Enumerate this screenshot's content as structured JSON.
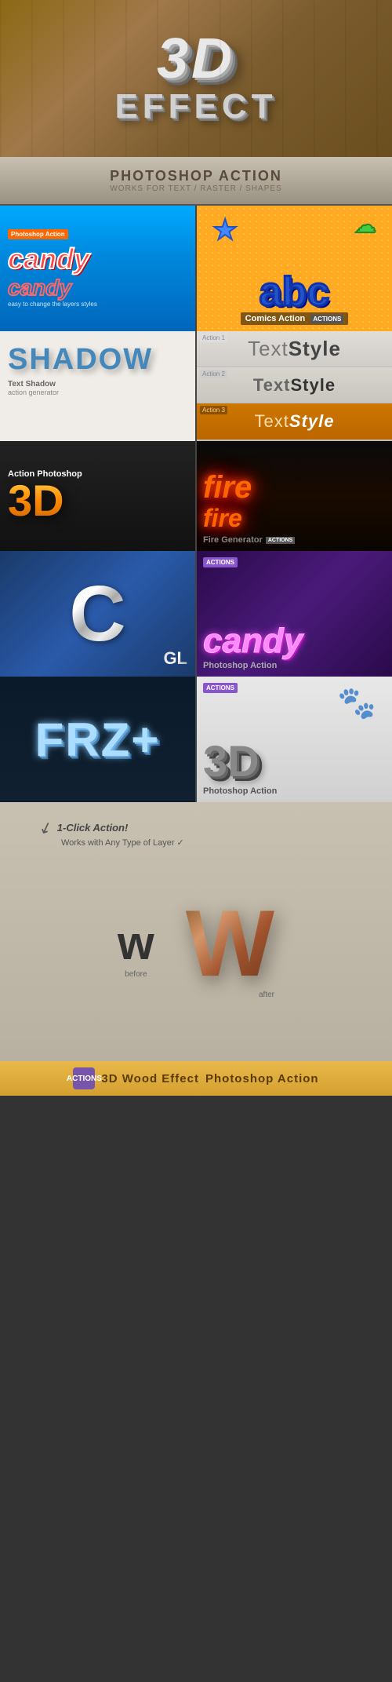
{
  "hero": {
    "text3d": "3D",
    "effect": "EFFECT"
  },
  "banner": {
    "title": "PHOTOSHOP ACTION",
    "subtitle": "WORKS FOR TEXT / RASTER / SHAPES"
  },
  "cards": {
    "candy1": {
      "badge": "Photoshop Action",
      "text1": "candy",
      "text2": "candy",
      "small": "easy to change the layers styles"
    },
    "comics": {
      "abc": "abc",
      "label": "Comics Action",
      "actions": "ACTIONS"
    },
    "shadow": {
      "main": "SHADOW",
      "sub1": "Text Shadow",
      "sub2": "action generator"
    },
    "textstyle": {
      "action1": "Action 1",
      "action2": "Action 2",
      "action3": "Action 3",
      "label_light1": "Text",
      "label_bold1": "Style",
      "label_light2": "Text",
      "label_bold2": "Style",
      "label_italic": "Text Style"
    },
    "action3d": {
      "title": "Action Photoshop",
      "text": "3D"
    },
    "fire": {
      "text1": "fire",
      "text2": "fire",
      "label": "Fire Generator",
      "actions": "ACTIONS"
    },
    "chrome": {
      "letter": "C",
      "small": "GL"
    },
    "candy2": {
      "text": "candy",
      "label": "Photoshop Action",
      "actions": "ACTIONS"
    },
    "freeze": {
      "text": "FRZ+"
    },
    "paw3d": {
      "text": "3D",
      "label": "Photoshop Action",
      "actions": "ACTIONS",
      "paw": "🐾"
    }
  },
  "wood": {
    "click_action": "1-Click Action!",
    "works_with": "Works with Any Type of Layer ✓",
    "w_before_label": "before",
    "w_after_label": "after",
    "w_flat": "w",
    "w_3d": "W",
    "bottom_text": "3D Wood Effect",
    "bottom_right": "Photoshop Action",
    "actions_label": "ACTIONS"
  }
}
